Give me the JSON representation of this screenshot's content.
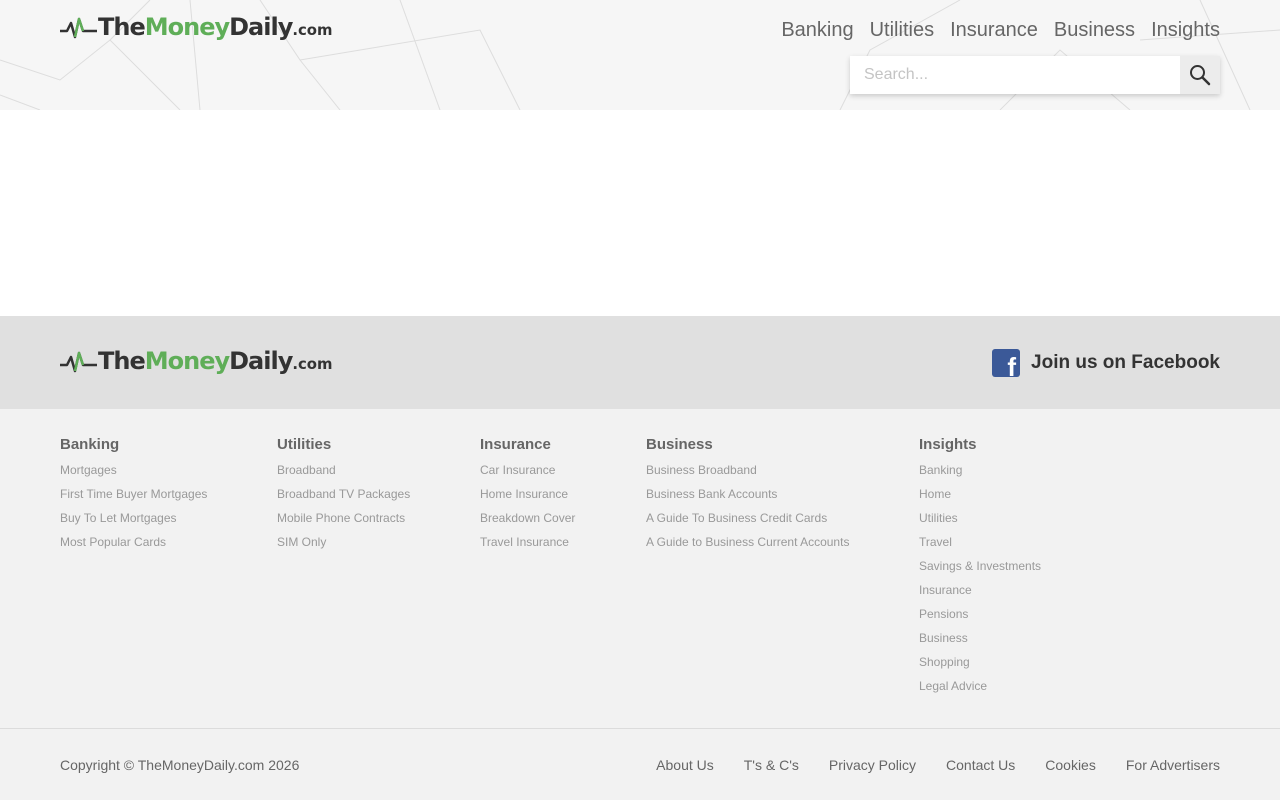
{
  "brand": {
    "the": "The",
    "money": "Money",
    "daily": "Daily",
    "dotcom": ".com",
    "colors": {
      "green": "#5fae58",
      "dark": "#333333"
    }
  },
  "header": {
    "nav": [
      "Banking",
      "Utilities",
      "Insurance",
      "Business",
      "Insights"
    ],
    "search": {
      "placeholder": "Search...",
      "value": "",
      "icon": "search-icon"
    }
  },
  "footer": {
    "facebook": {
      "label": "Join us on Facebook",
      "icon": "facebook-icon",
      "color": "#3b5998"
    },
    "columns": [
      {
        "title": "Banking",
        "links": [
          "Mortgages",
          "First Time Buyer Mortgages",
          "Buy To Let Mortgages",
          "Most Popular Cards"
        ]
      },
      {
        "title": "Utilities",
        "links": [
          "Broadband",
          "Broadband TV Packages",
          "Mobile Phone Contracts",
          "SIM Only"
        ]
      },
      {
        "title": "Insurance",
        "links": [
          "Car Insurance",
          "Home Insurance",
          "Breakdown Cover",
          "Travel Insurance"
        ]
      },
      {
        "title": "Business",
        "links": [
          "Business Broadband",
          "Business Bank Accounts",
          "A Guide To Business Credit Cards",
          "A Guide to Business Current Accounts"
        ]
      },
      {
        "title": "Insights",
        "links": [
          "Banking",
          "Home",
          "Utilities",
          "Travel",
          "Savings & Investments",
          "Insurance",
          "Pensions",
          "Business",
          "Shopping",
          "Legal Advice"
        ]
      }
    ],
    "copyright": "Copyright © TheMoneyDaily.com 2026",
    "bottom_nav": [
      "About Us",
      "T's & C's",
      "Privacy Policy",
      "Contact Us",
      "Cookies",
      "For Advertisers"
    ]
  }
}
